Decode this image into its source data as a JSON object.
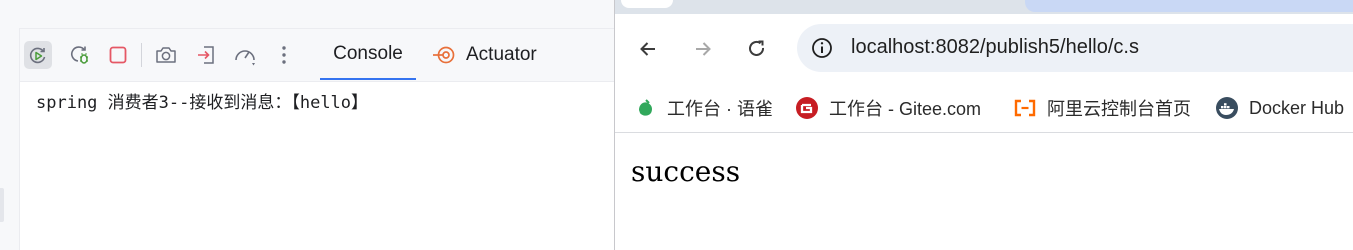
{
  "ide": {
    "toolbar": {
      "icons": [
        "rerun-icon",
        "rerun-debug-icon",
        "stop-icon",
        "camera-icon",
        "login-icon",
        "gauge-icon",
        "more-vertical-icon"
      ],
      "tabs": [
        {
          "label": "Console",
          "active": true
        },
        {
          "label": "Actuator",
          "active": false
        }
      ]
    },
    "console": {
      "output_line": "spring 消费者3--接收到消息：【hello】"
    },
    "colors": {
      "accent": "#3574f0",
      "stop": "#e55765",
      "run": "#4a9c3a",
      "actuator": "#e8703a"
    }
  },
  "browser": {
    "address": "localhost:8082/publish5/hello/c.s",
    "bookmarks": [
      {
        "label": "工作台 · 语雀",
        "icon": "yuque-icon"
      },
      {
        "label": "工作台 - Gitee.com",
        "icon": "gitee-icon"
      },
      {
        "label": "阿里云控制台首页",
        "icon": "aliyun-icon"
      },
      {
        "label": "Docker Hub",
        "icon": "docker-icon"
      }
    ],
    "page": {
      "text": "success"
    }
  }
}
